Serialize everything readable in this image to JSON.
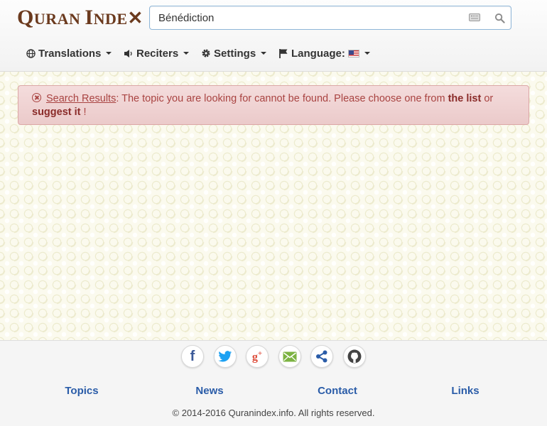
{
  "header": {
    "logo_text": "Quran Index",
    "search": {
      "value": "Bénédiction",
      "placeholder": ""
    }
  },
  "nav": {
    "translations_label": "Translations",
    "reciters_label": "Reciters",
    "settings_label": "Settings",
    "language_label": "Language:"
  },
  "alert": {
    "link_label": "Search Results",
    "message": ": The topic you are looking for cannot be found. Please choose one from ",
    "list_link": "the list",
    "or_text": " or",
    "suggest_link": "suggest it",
    "end_text": " !"
  },
  "footer": {
    "links": [
      "Topics",
      "News",
      "Contact",
      "Links"
    ],
    "copyright": "© 2014-2016 Quranindex.info. All rights reserved."
  },
  "colors": {
    "alert_text": "#a94442",
    "alert_bg": "#f2dede",
    "footer_link": "#2a5ca8",
    "logo": "#6b3a1e"
  }
}
